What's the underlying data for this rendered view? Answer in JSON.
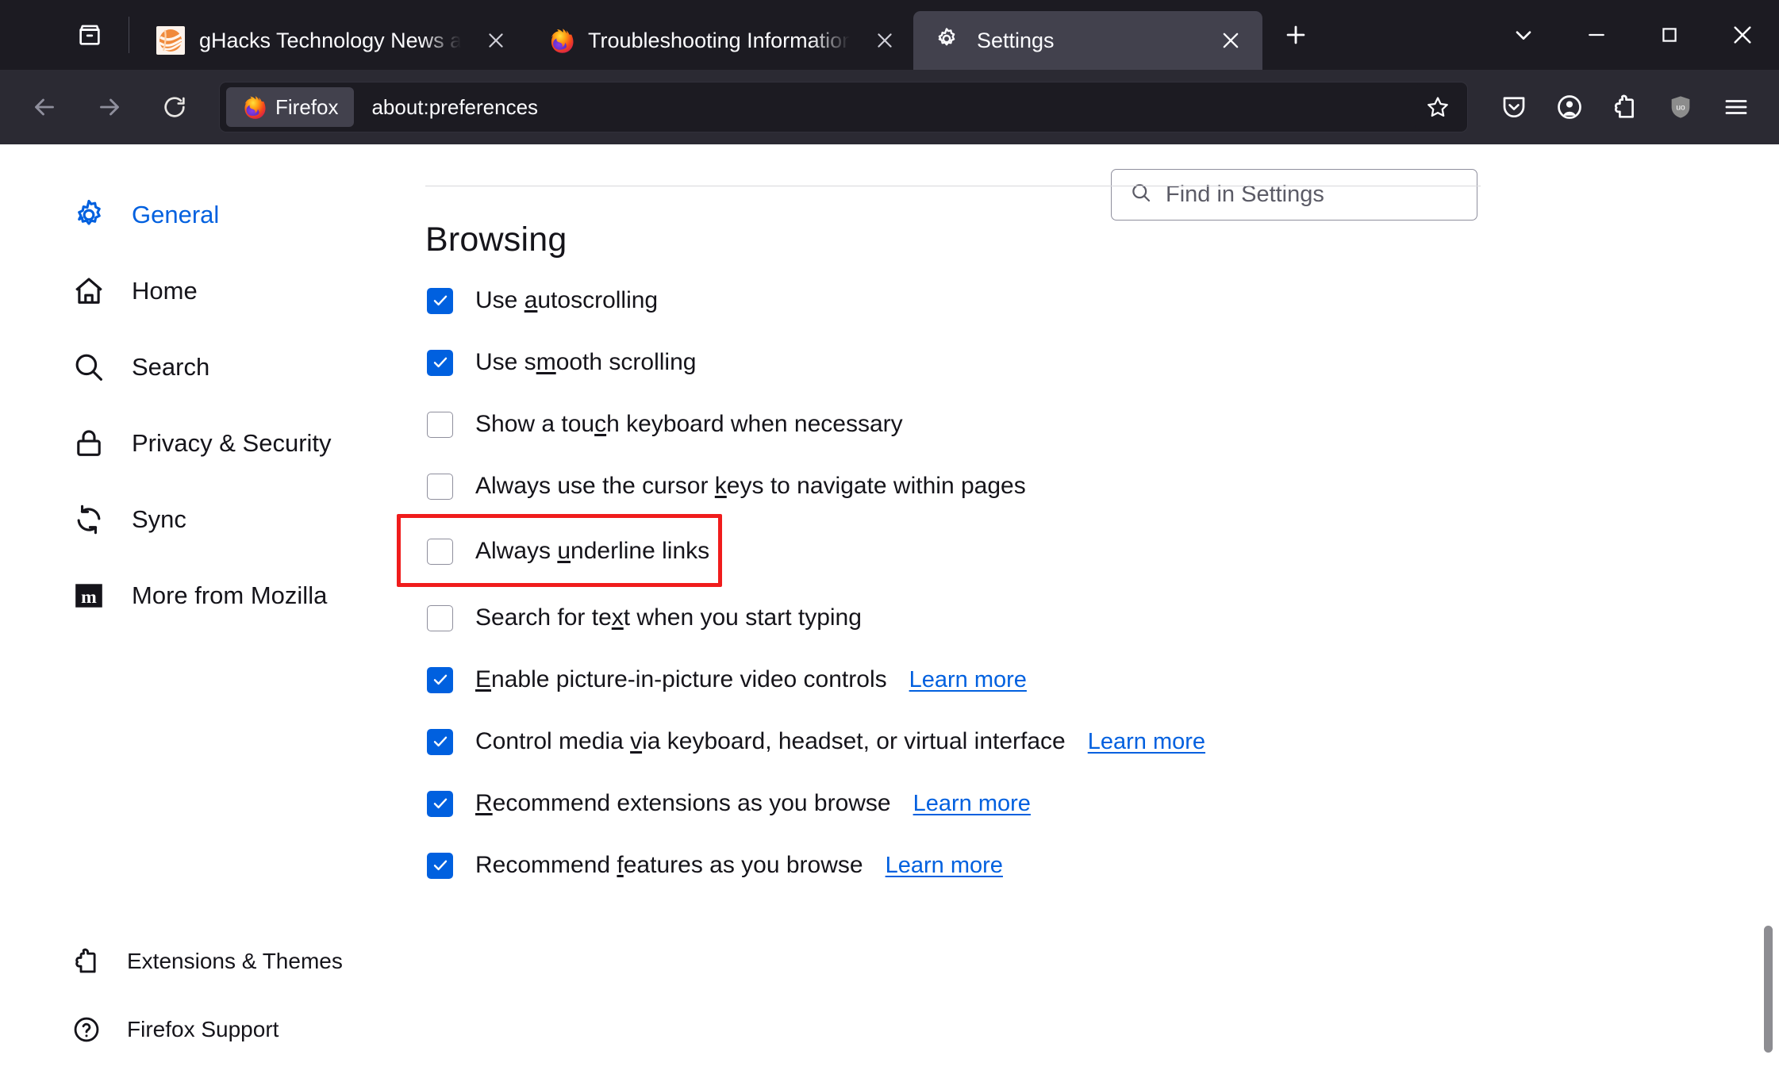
{
  "window": {
    "controls": [
      {
        "name": "list-all-tabs",
        "glyph": "chevron-down"
      },
      {
        "name": "minimize",
        "glyph": "minimize"
      },
      {
        "name": "maximize",
        "glyph": "maximize"
      },
      {
        "name": "close",
        "glyph": "close"
      }
    ]
  },
  "tabstrip": {
    "firefox_view_label": "Firefox View",
    "new_tab_label": "Open a new tab",
    "tabs": [
      {
        "title": "gHacks Technology News and A",
        "favicon": "ghacks-icon",
        "active": false,
        "close_label": "Close tab"
      },
      {
        "title": "Troubleshooting Information",
        "favicon": "firefox-icon",
        "active": false,
        "close_label": "Close tab"
      },
      {
        "title": "Settings",
        "favicon": "gear-icon",
        "active": true,
        "close_label": "Close tab"
      }
    ]
  },
  "navbar": {
    "back_label": "Go back one page",
    "forward_label": "Go forward one page",
    "reload_label": "Reload current page",
    "identity_label": "Firefox",
    "url": "about:preferences",
    "bookmark_label": "Bookmark this page",
    "right_buttons": [
      {
        "name": "pocket-icon",
        "label": "Save to Pocket"
      },
      {
        "name": "account-icon",
        "label": "Account"
      },
      {
        "name": "extensions-icon",
        "label": "Extensions"
      },
      {
        "name": "ublock-origin-icon",
        "label": "uBlock Origin"
      },
      {
        "name": "hamburger-menu-icon",
        "label": "Open application menu"
      }
    ]
  },
  "search": {
    "placeholder": "Find in Settings",
    "value": "",
    "icon": "search-icon"
  },
  "sidebar": {
    "items": [
      {
        "label": "General",
        "icon": "gear-icon",
        "selected": true
      },
      {
        "label": "Home",
        "icon": "home-icon",
        "selected": false
      },
      {
        "label": "Search",
        "icon": "search-icon",
        "selected": false
      },
      {
        "label": "Privacy & Security",
        "icon": "lock-icon",
        "selected": false
      },
      {
        "label": "Sync",
        "icon": "sync-icon",
        "selected": false
      },
      {
        "label": "More from Mozilla",
        "icon": "mozilla-m-icon",
        "selected": false
      }
    ],
    "bottom_items": [
      {
        "label": "Extensions & Themes",
        "icon": "extensions-icon"
      },
      {
        "label": "Firefox Support",
        "icon": "help-circle-icon"
      }
    ]
  },
  "main": {
    "section_title": "Browsing",
    "options": [
      {
        "label_before": "Use ",
        "accesskey": "a",
        "label_after": "utoscrolling",
        "checked": true,
        "learn_more": null
      },
      {
        "label_before": "Use s",
        "accesskey": "m",
        "label_after": "ooth scrolling",
        "checked": true,
        "learn_more": null
      },
      {
        "label_before": "Show a tou",
        "accesskey": "c",
        "label_after": "h keyboard when necessary",
        "checked": false,
        "learn_more": null
      },
      {
        "label_before": "Always use the cursor ",
        "accesskey": "k",
        "label_after": "eys to navigate within pages",
        "checked": false,
        "learn_more": null
      },
      {
        "label_before": "Always ",
        "accesskey": "u",
        "label_after": "nderline links",
        "checked": false,
        "learn_more": null,
        "highlighted": true
      },
      {
        "label_before": "Search for te",
        "accesskey": "x",
        "label_after": "t when you start typing",
        "checked": false,
        "learn_more": null
      },
      {
        "label_before": "",
        "accesskey": "E",
        "label_after": "nable picture-in-picture video controls",
        "checked": true,
        "learn_more": "Learn more"
      },
      {
        "label_before": "Control media ",
        "accesskey": "v",
        "label_after": "ia keyboard, headset, or virtual interface",
        "checked": true,
        "learn_more": "Learn more"
      },
      {
        "label_before": "",
        "accesskey": "R",
        "label_after": "ecommend extensions as you browse",
        "checked": true,
        "learn_more": "Learn more"
      },
      {
        "label_before": "Recommend ",
        "accesskey": "f",
        "label_after": "eatures as you browse",
        "checked": true,
        "learn_more": "Learn more"
      }
    ]
  },
  "colors": {
    "accent": "#0060df",
    "annotation": "#f01c1c",
    "chrome_tabstrip": "#1c1b22",
    "chrome_navbar": "#2b2a33",
    "active_tab": "#42414d"
  }
}
